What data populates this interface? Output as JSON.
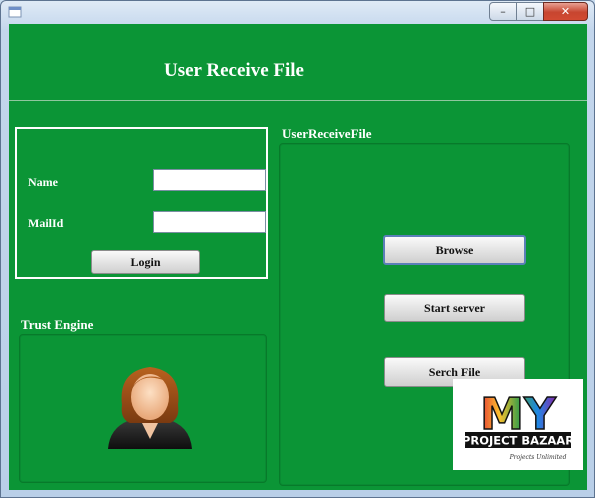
{
  "window": {
    "controls": {
      "minimize": "–",
      "maximize": "□",
      "close": "✕"
    }
  },
  "header": {
    "title": "User Receive File"
  },
  "login": {
    "name_label": "Name",
    "name_value": "",
    "mail_label": "MailId",
    "mail_value": "",
    "login_button": "Login"
  },
  "trust": {
    "title": "Trust Engine"
  },
  "receive": {
    "title": "UserReceiveFile",
    "browse_button": "Browse",
    "start_server_button": "Start server",
    "search_button": "Serch File"
  },
  "watermark": {
    "line1": "MY",
    "line2": "PROJECT BAZAAR",
    "line3": "Projects Unlimited"
  },
  "colors": {
    "background": "#0b9536",
    "text": "#ffffff"
  }
}
